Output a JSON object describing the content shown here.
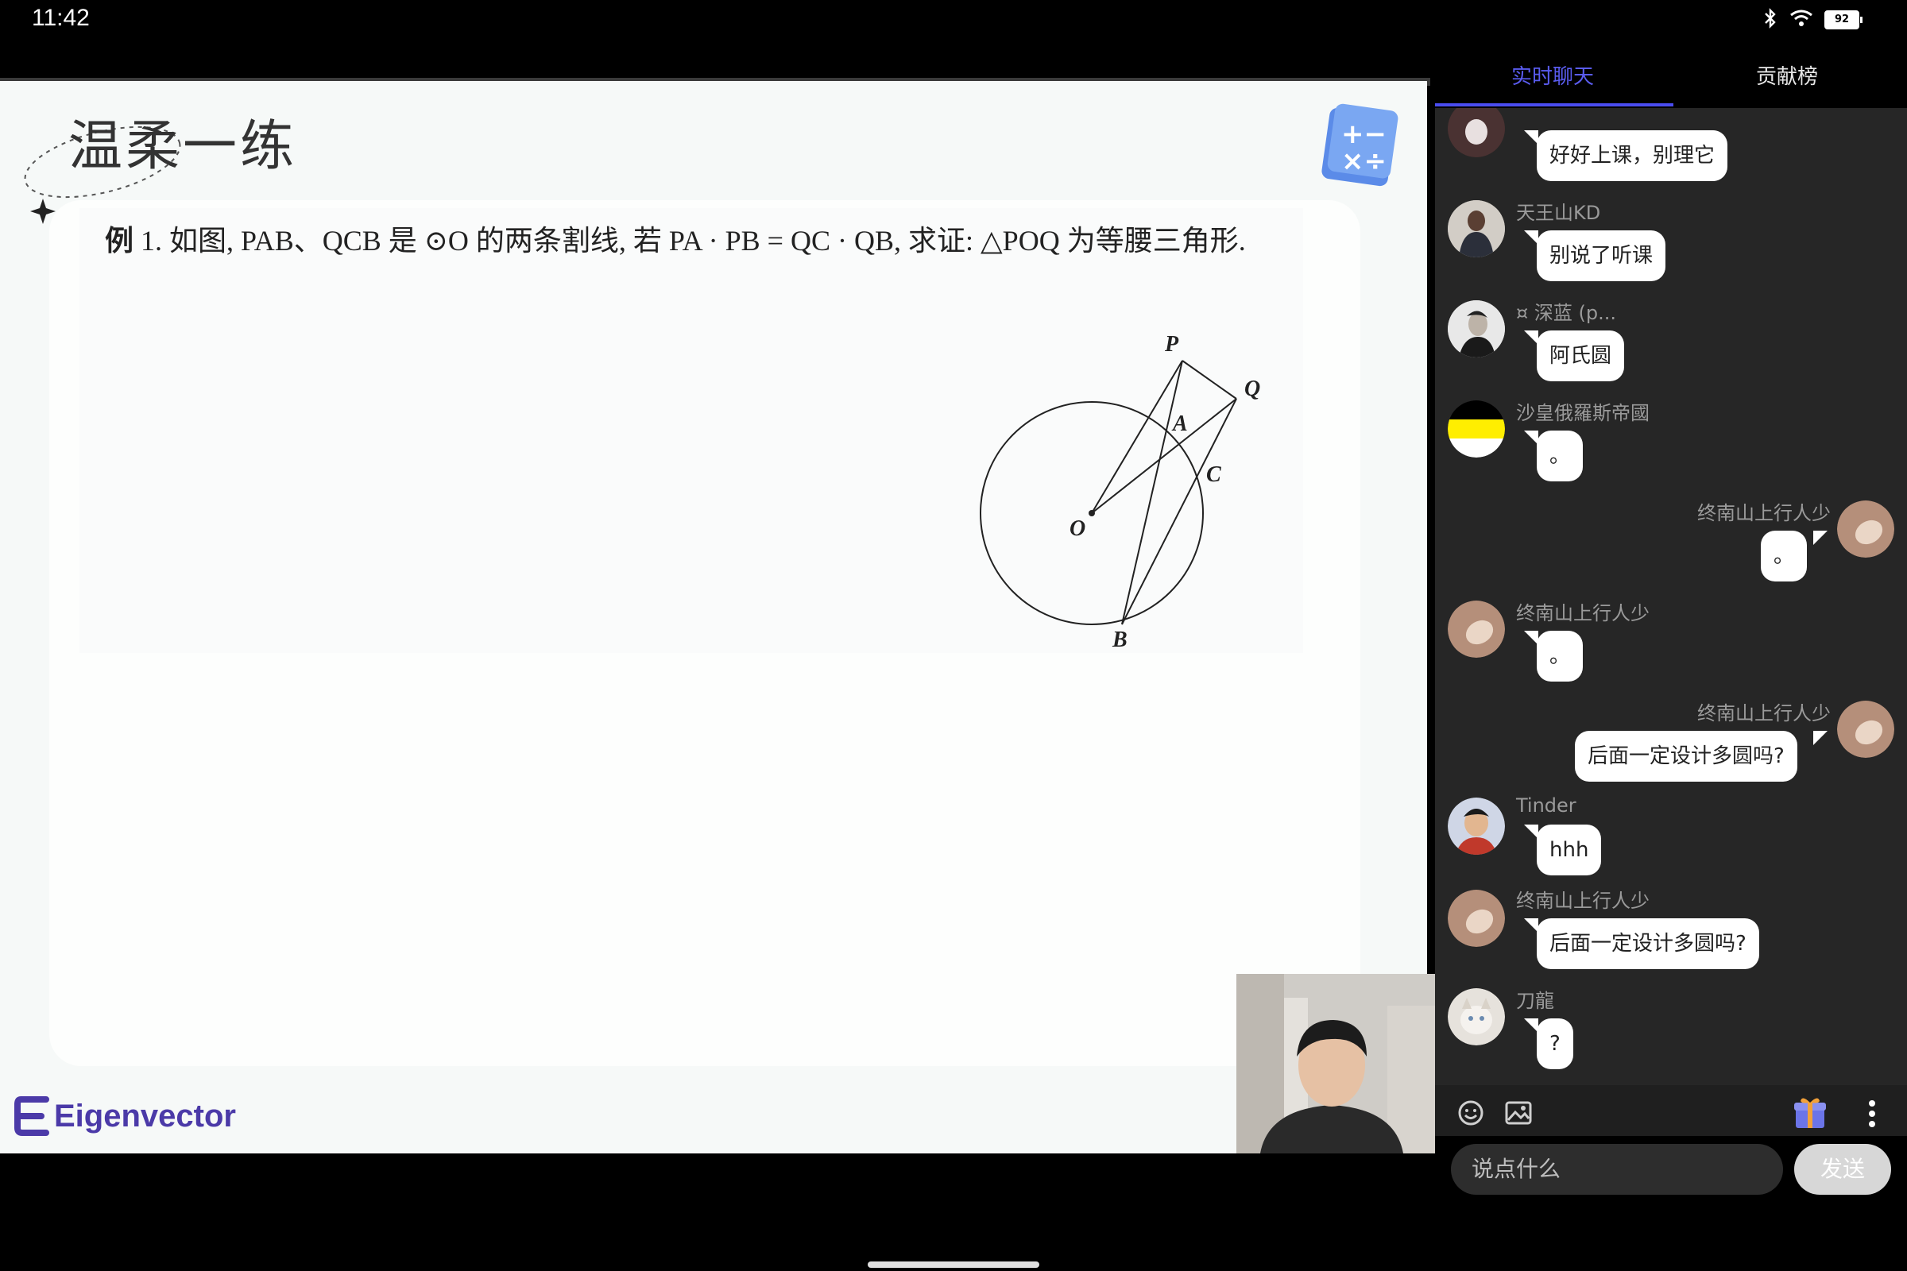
{
  "status_bar": {
    "time": "11:42",
    "battery": "92"
  },
  "slide": {
    "title": "温柔一练",
    "problem_prefix": "例",
    "problem_text": " 1. 如图, PAB、QCB 是 ⊙O 的两条割线, 若 PA · PB = QC · QB, 求证: △POQ 为等腰三角形.",
    "figure_labels": {
      "P": "P",
      "Q": "Q",
      "A": "A",
      "C": "C",
      "O": "O",
      "B": "B"
    },
    "brand": "Eigenvector"
  },
  "chat": {
    "tabs": [
      "实时聊天",
      "贡献榜"
    ],
    "messages": [
      {
        "user": "",
        "text": "好好上课，别理它",
        "side": "left"
      },
      {
        "user": "天王山KD",
        "text": "别说了听课",
        "side": "left"
      },
      {
        "user": "¤ 深蓝 (p...",
        "text": "阿氏圆",
        "side": "left"
      },
      {
        "user": "沙皇俄羅斯帝國",
        "text": "。",
        "side": "left"
      },
      {
        "user": "终南山上行人少",
        "text": "。",
        "side": "right"
      },
      {
        "user": "终南山上行人少",
        "text": "。",
        "side": "left"
      },
      {
        "user": "终南山上行人少",
        "text": "后面一定设计多圆吗?",
        "side": "right"
      },
      {
        "user": "Tinder",
        "text": "hhh",
        "side": "left"
      },
      {
        "user": "终南山上行人少",
        "text": "后面一定设计多圆吗?",
        "side": "left"
      },
      {
        "user": "刀龍",
        "text": "?",
        "side": "left"
      }
    ],
    "input_placeholder": "说点什么",
    "send_label": "发送"
  },
  "icons": [
    "bluetooth-icon",
    "wifi-icon",
    "battery-icon",
    "emoji-icon",
    "image-icon",
    "gift-icon",
    "more-icon"
  ]
}
